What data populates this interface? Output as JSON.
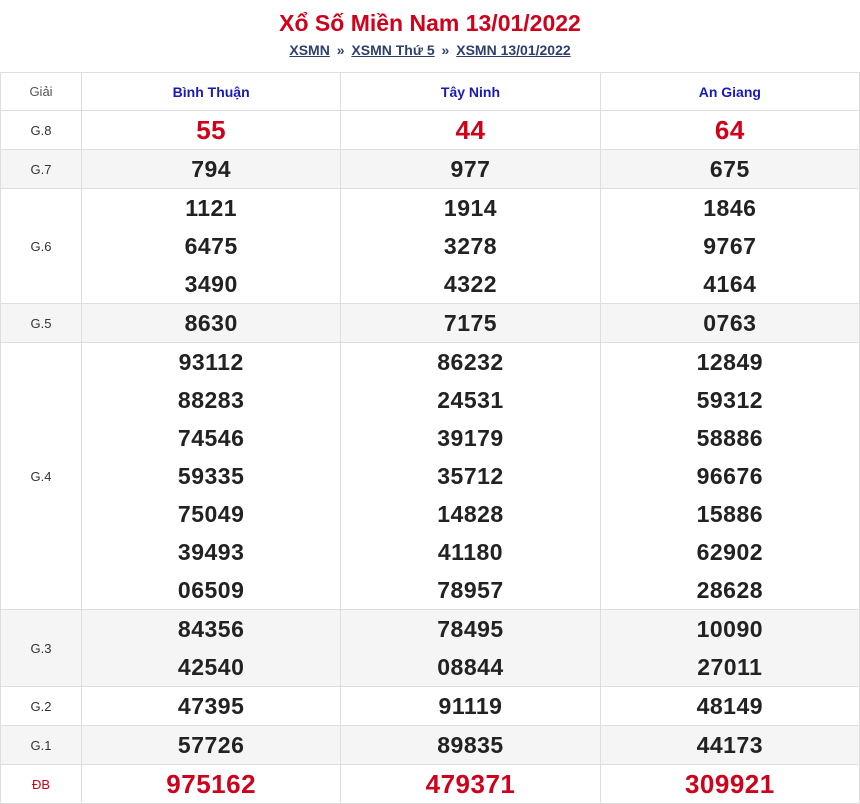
{
  "title": "Xổ Số Miền Nam 13/01/2022",
  "breadcrumb": {
    "items": [
      "XSMN",
      "XSMN Thứ 5",
      "XSMN 13/01/2022"
    ],
    "separator": "»"
  },
  "table": {
    "header_label": "Giải",
    "provinces": [
      "Bình Thuận",
      "Tây Ninh",
      "An Giang"
    ],
    "prizes": [
      {
        "label": "G.8",
        "values": [
          [
            "55"
          ],
          [
            "44"
          ],
          [
            "64"
          ]
        ]
      },
      {
        "label": "G.7",
        "values": [
          [
            "794"
          ],
          [
            "977"
          ],
          [
            "675"
          ]
        ]
      },
      {
        "label": "G.6",
        "values": [
          [
            "1121",
            "6475",
            "3490"
          ],
          [
            "1914",
            "3278",
            "4322"
          ],
          [
            "1846",
            "9767",
            "4164"
          ]
        ]
      },
      {
        "label": "G.5",
        "values": [
          [
            "8630"
          ],
          [
            "7175"
          ],
          [
            "0763"
          ]
        ]
      },
      {
        "label": "G.4",
        "values": [
          [
            "93112",
            "88283",
            "74546",
            "59335",
            "75049",
            "39493",
            "06509"
          ],
          [
            "86232",
            "24531",
            "39179",
            "35712",
            "14828",
            "41180",
            "78957"
          ],
          [
            "12849",
            "59312",
            "58886",
            "96676",
            "15886",
            "62902",
            "28628"
          ]
        ]
      },
      {
        "label": "G.3",
        "values": [
          [
            "84356",
            "42540"
          ],
          [
            "78495",
            "08844"
          ],
          [
            "10090",
            "27011"
          ]
        ]
      },
      {
        "label": "G.2",
        "values": [
          [
            "47395"
          ],
          [
            "91119"
          ],
          [
            "48149"
          ]
        ]
      },
      {
        "label": "G.1",
        "values": [
          [
            "57726"
          ],
          [
            "89835"
          ],
          [
            "44173"
          ]
        ]
      },
      {
        "label": "ĐB",
        "values": [
          [
            "975162"
          ],
          [
            "479371"
          ],
          [
            "309921"
          ]
        ]
      }
    ]
  },
  "colors": {
    "title": "#d0021b",
    "province": "#1a1ab8",
    "link": "#2e3f6e",
    "special": "#d0021b"
  }
}
